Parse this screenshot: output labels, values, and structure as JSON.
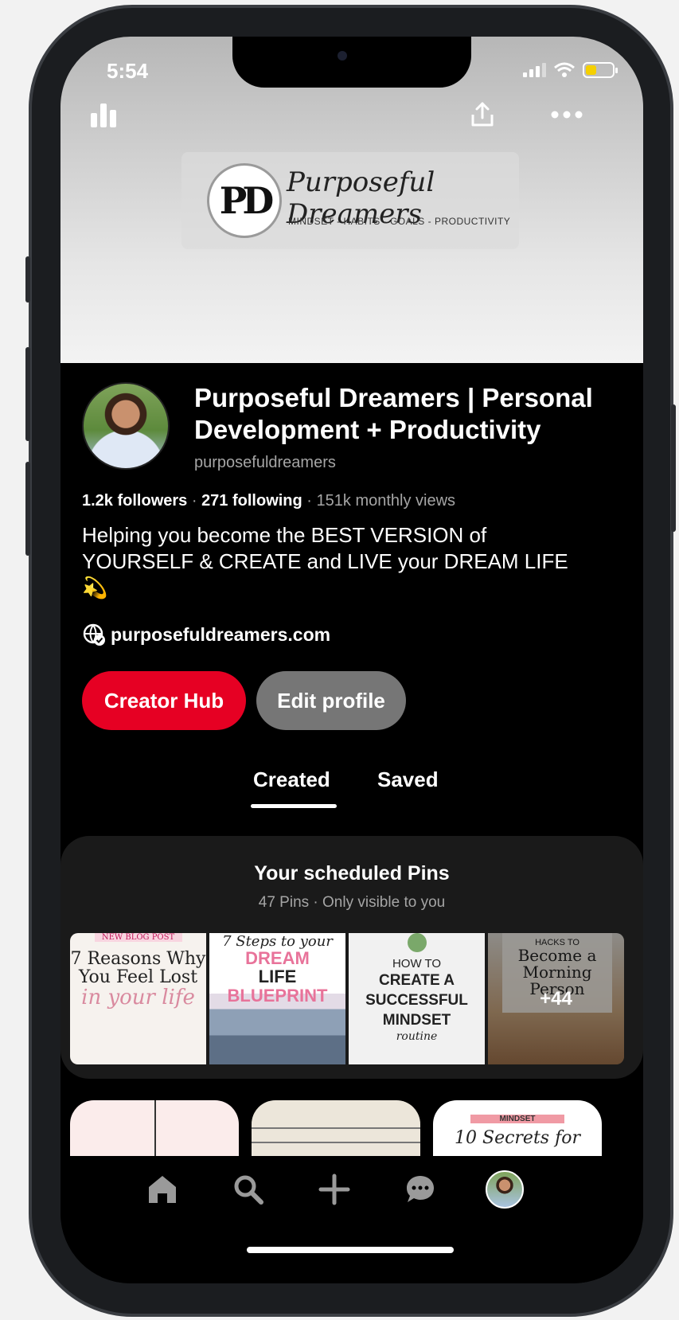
{
  "status_bar": {
    "time": "5:54",
    "battery_color": "#f5d000"
  },
  "cover": {
    "logo_monogram": "PD",
    "logo_title": "Purposeful Dreamers",
    "logo_tagline": "MINDSET - HABITS - GOALS - PRODUCTIVITY",
    "icons": {
      "analytics": "bar-chart-icon",
      "share": "share-icon",
      "more": "more-icon"
    }
  },
  "profile": {
    "name": "Purposeful Dreamers | Personal Development + Productivity",
    "handle": "purposefuldreamers",
    "followers": "1.2k followers",
    "following": "271 following",
    "monthly_views": "151k monthly views",
    "bio": "Helping you become the BEST VERSION of YOURSELF  & CREATE and LIVE your DREAM LIFE 💫",
    "website": "purposefuldreamers.com"
  },
  "buttons": {
    "creator_hub": "Creator Hub",
    "edit_profile": "Edit profile"
  },
  "tabs": [
    {
      "label": "Created",
      "active": true
    },
    {
      "label": "Saved",
      "active": false
    }
  ],
  "scheduled": {
    "title": "Your scheduled Pins",
    "subtitle": "47 Pins · Only visible to you",
    "thumbs": [
      {
        "tag": "NEW BLOG POST",
        "line1": "7 Reasons Why You Feel Lost",
        "line2": "in your life"
      },
      {
        "line1": "7 Steps to your",
        "line2": "DREAM",
        "line3": "LIFE",
        "line4": "BLUEPRINT"
      },
      {
        "line1": "HOW TO",
        "line2": "CREATE A SUCCESSFUL MINDSET",
        "line3": "routine"
      },
      {
        "line1": "HACKS TO",
        "line2": "Become a Morning Person",
        "more": "+44"
      }
    ]
  },
  "pins_preview": {
    "pin3_band": "MINDSET",
    "pin3_text": "10 Secrets for"
  },
  "colors": {
    "accent": "#e60023",
    "secondary_button": "#767676",
    "background": "#000000"
  }
}
